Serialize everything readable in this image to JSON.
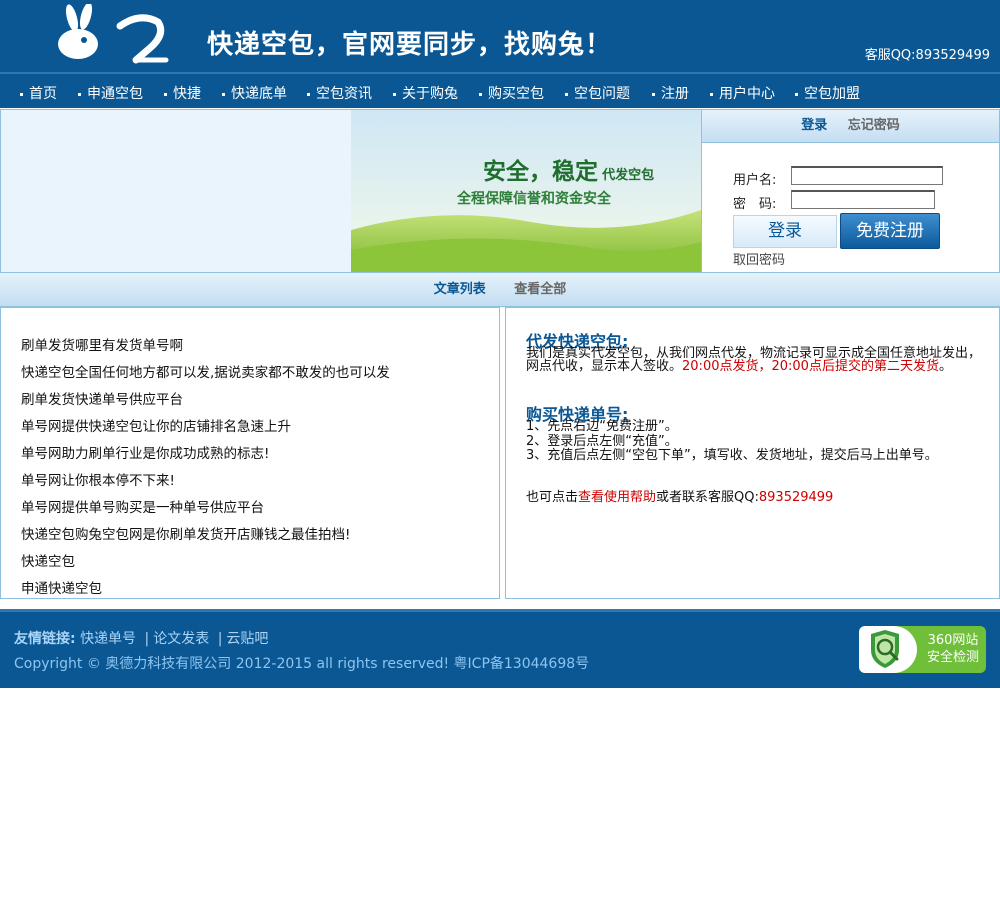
{
  "header": {
    "logo_text": "购兔.COM goo2",
    "slogan": "快递空包，官网要同步，找购兔！",
    "qq": "客服QQ:893529499"
  },
  "nav": [
    "首页",
    "申通空包",
    "快捷",
    "快递底单",
    "空包资讯",
    "关于购兔",
    "购买空包",
    "空包问题",
    "注册",
    "用户中心",
    "空包加盟"
  ],
  "banner": {
    "headline_big": "安全，稳定",
    "headline_small": "代发空包",
    "subline": "全程保障信誉和资金安全"
  },
  "login": {
    "tab_login": "登录",
    "tab_forgot": "忘记密码",
    "username_label": "用户名:",
    "password_label": "密　码:",
    "login_button": "登录",
    "register_button": "免费注册",
    "recover_link": "取回密码"
  },
  "section": {
    "tab_list": "文章列表",
    "tab_all": "查看全部"
  },
  "articles": [
    "刷单发货哪里有发货单号啊",
    "快递空包全国任何地方都可以发,据说卖家都不敢发的也可以发",
    "刷单发货快递单号供应平台",
    "单号网提供快递空包让你的店铺排名急速上升",
    "单号网助力刷单行业是你成功成熟的标志!",
    "单号网让你根本停不下来!",
    "单号网提供单号购买是一种单号供应平台",
    "快递空包购兔空包网是你刷单发货开店赚钱之最佳拍档!",
    "快递空包",
    "申通快递空包"
  ],
  "info": {
    "title1": "代发快递空包:",
    "para1": "我们是真实代发空包，从我们网点代发，物流记录可显示成全国任意地址发出，网点代收，显示本人签收。",
    "para1_red": "20:00点发货，20:00点后提交的第二天发货",
    "para1_end": "。",
    "title2": "购买快递单号:",
    "step1": "1、先点右边“免费注册”。",
    "step2": "2、登录后点左侧“充值”。",
    "step3": "3、充值后点左侧“空包下单”，填写收、发货地址，提交后马上出单号。",
    "help_prefix": "也可点击",
    "help_link": "查看使用帮助",
    "help_mid": "或者联系客服QQ:",
    "help_qq": "893529499"
  },
  "footer": {
    "friends_label": "友情链接:",
    "friends": [
      "快递单号",
      "论文发表",
      "云贴吧"
    ],
    "copyright": "Copyright © 奥德力科技有限公司  2012-2015 all rights reserved! 粤ICP备13044698号",
    "badge_line1": "360网站",
    "badge_line2": "安全检测"
  },
  "colors": {
    "primary": "#0a5794",
    "border": "#8fc1df",
    "accent_red": "#cc0000"
  }
}
